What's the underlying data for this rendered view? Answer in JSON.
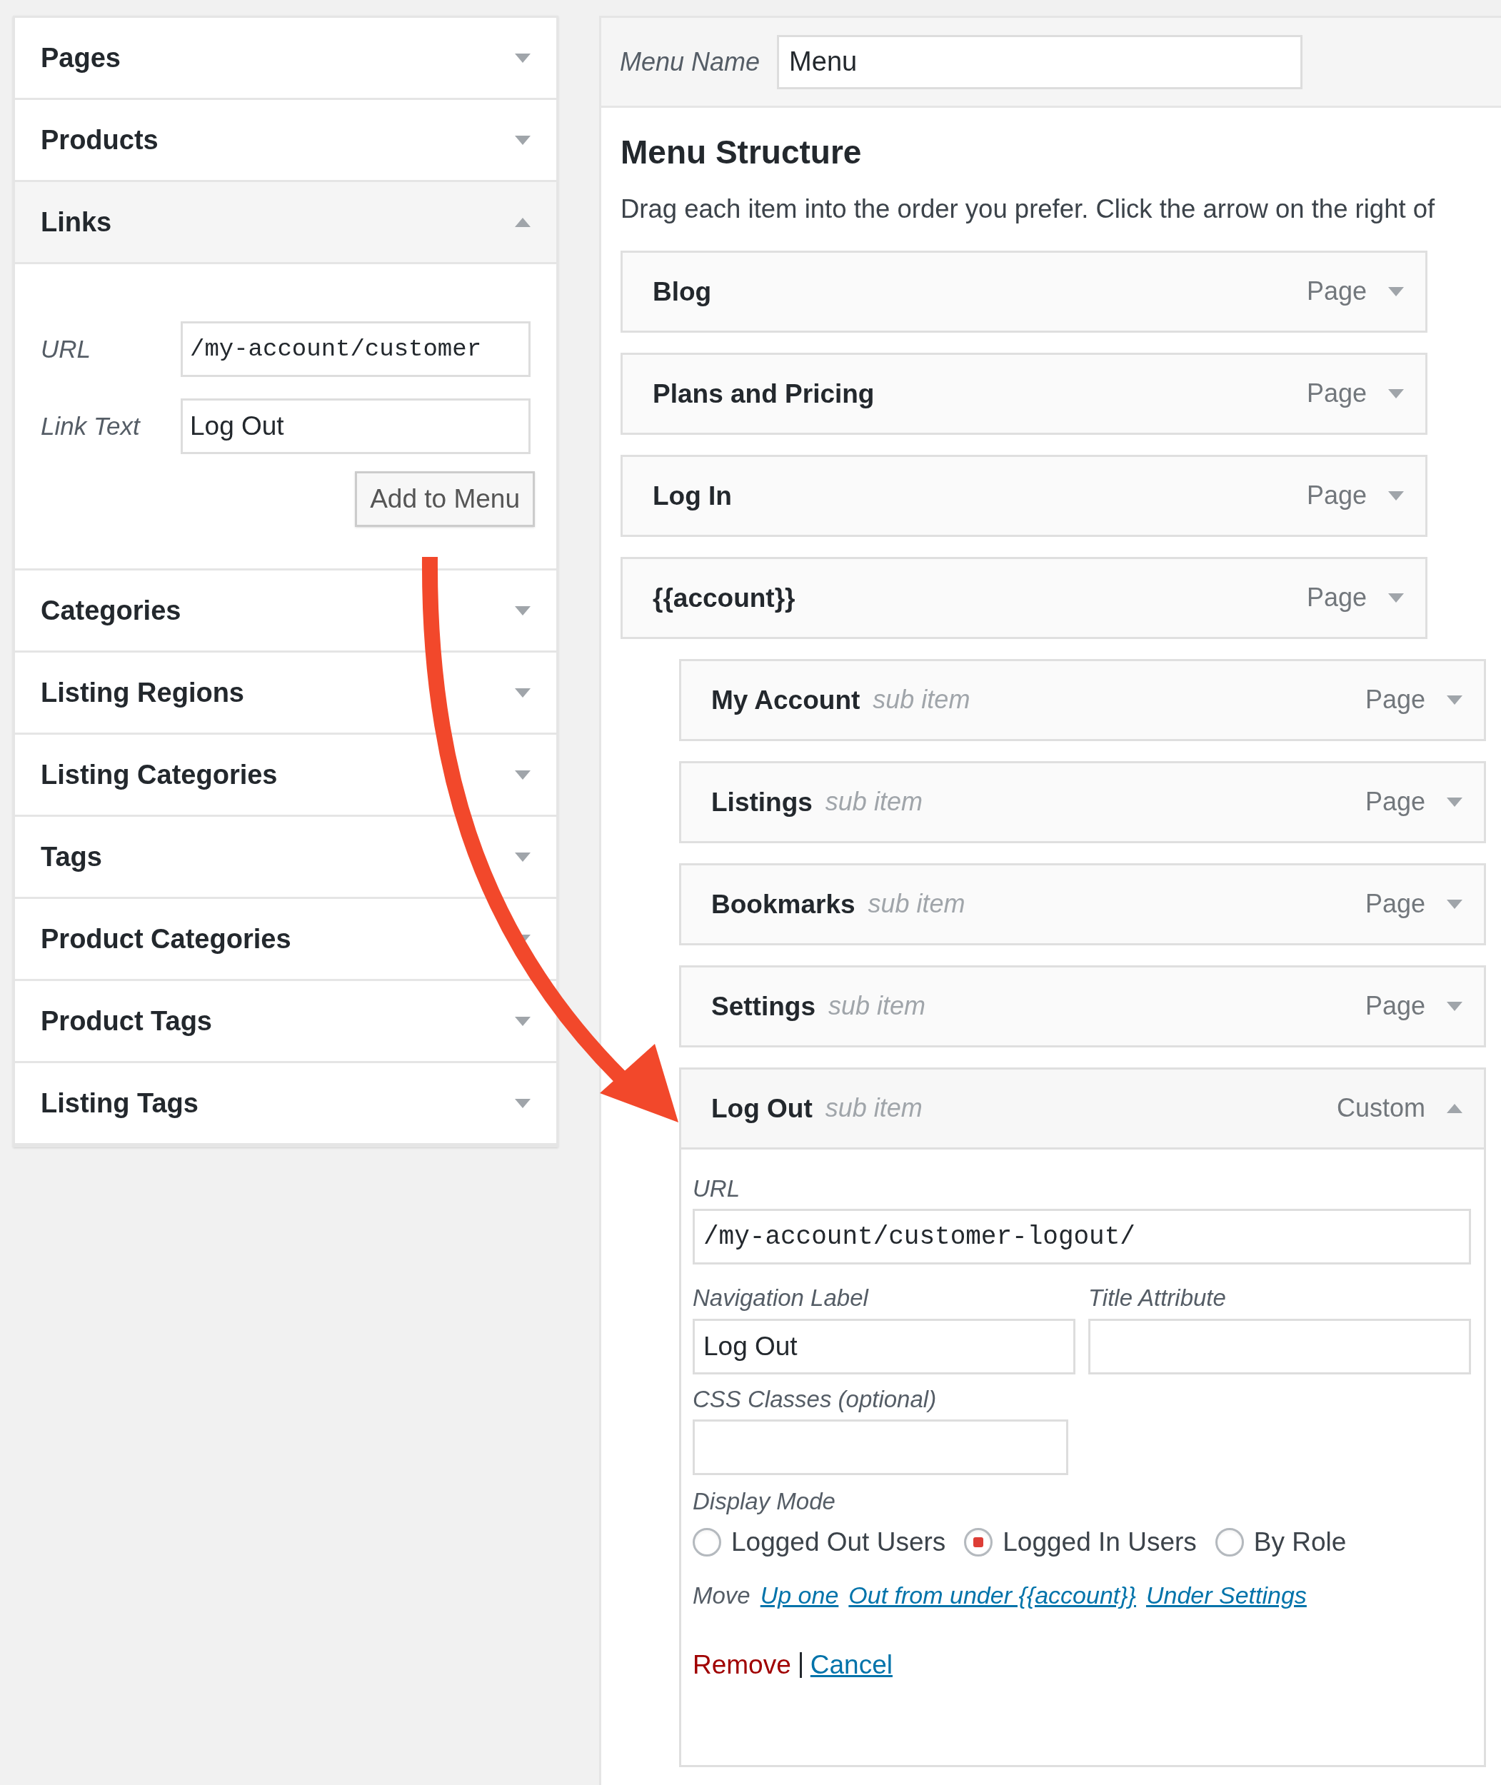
{
  "left_panel": {
    "sections": [
      {
        "title": "Pages",
        "expanded": false
      },
      {
        "title": "Products",
        "expanded": false
      },
      {
        "title": "Links",
        "expanded": true,
        "fields": [
          {
            "label": "URL",
            "value": "/my-account/customer",
            "kind": "mono"
          },
          {
            "label": "Link Text",
            "value": "Log Out",
            "kind": "text"
          }
        ],
        "button": "Add to Menu"
      },
      {
        "title": "Categories",
        "expanded": false
      },
      {
        "title": "Listing Regions",
        "expanded": false
      },
      {
        "title": "Listing Categories",
        "expanded": false
      },
      {
        "title": "Tags",
        "expanded": false
      },
      {
        "title": "Product Categories",
        "expanded": false
      },
      {
        "title": "Product Tags",
        "expanded": false
      },
      {
        "title": "Listing Tags",
        "expanded": false
      }
    ]
  },
  "menu_name": {
    "label": "Menu Name",
    "value": "Menu"
  },
  "menu_structure": {
    "heading": "Menu Structure",
    "description": "Drag each item into the order you prefer. Click the arrow on the right of",
    "items": [
      {
        "title": "Blog",
        "type": "Page",
        "expanded": false
      },
      {
        "title": "Plans and Pricing",
        "type": "Page",
        "expanded": false
      },
      {
        "title": "Log In",
        "type": "Page",
        "expanded": false
      },
      {
        "title": "{{account}}",
        "type": "Page",
        "expanded": false,
        "children": [
          {
            "title": "My Account",
            "suffix": "sub item",
            "type": "Page",
            "expanded": false
          },
          {
            "title": "Listings",
            "suffix": "sub item",
            "type": "Page",
            "expanded": false
          },
          {
            "title": "Bookmarks",
            "suffix": "sub item",
            "type": "Page",
            "expanded": false
          },
          {
            "title": "Settings",
            "suffix": "sub item",
            "type": "Page",
            "expanded": false
          },
          {
            "title": "Log Out",
            "suffix": "sub item",
            "type": "Custom",
            "expanded": true,
            "settings": {
              "url": {
                "label": "URL",
                "value": "/my-account/customer-logout/"
              },
              "navigation_label": {
                "label": "Navigation Label",
                "value": "Log Out"
              },
              "title_attribute": {
                "label": "Title Attribute"
              },
              "css_classes": {
                "label": "CSS Classes (optional)"
              },
              "display_mode": {
                "label": "Display Mode",
                "options": [
                  {
                    "label": "Logged Out Users",
                    "selected": false
                  },
                  {
                    "label": "Logged In Users",
                    "selected": true
                  },
                  {
                    "label": "By Role",
                    "selected": false
                  }
                ]
              },
              "move": {
                "label": "Move",
                "links": [
                  "Up one",
                  "Out from under {{account}}",
                  "Under Settings"
                ]
              },
              "actions": [
                {
                  "label": "Remove",
                  "kind": "danger"
                },
                {
                  "label": "Cancel",
                  "kind": "link"
                }
              ]
            }
          }
        ]
      }
    ]
  }
}
